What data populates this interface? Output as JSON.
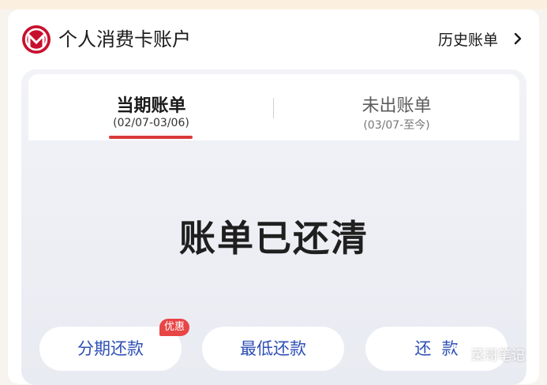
{
  "header": {
    "title": "个人消费卡账户",
    "history_link": "历史账单"
  },
  "tabs": [
    {
      "label": "当期账单",
      "date_range": "(02/07-03/06)",
      "active": true
    },
    {
      "label": "未出账单",
      "date_range": "(03/07-至今)",
      "active": false
    }
  ],
  "bill_status": "账单已还清",
  "actions": {
    "installment": {
      "label": "分期还款",
      "badge": "优惠"
    },
    "minimum": {
      "label": "最低还款"
    },
    "repay": {
      "label": "还  款"
    }
  },
  "watermark": "菜哥笔记",
  "colors": {
    "brand": "#c8102e",
    "accent_underline": "#d93a3a",
    "button_text": "#2e4fb5",
    "badge": "#e84545"
  },
  "icons": {
    "logo": "bank-logo-icon",
    "history_chevron": "chevron-right-icon"
  }
}
